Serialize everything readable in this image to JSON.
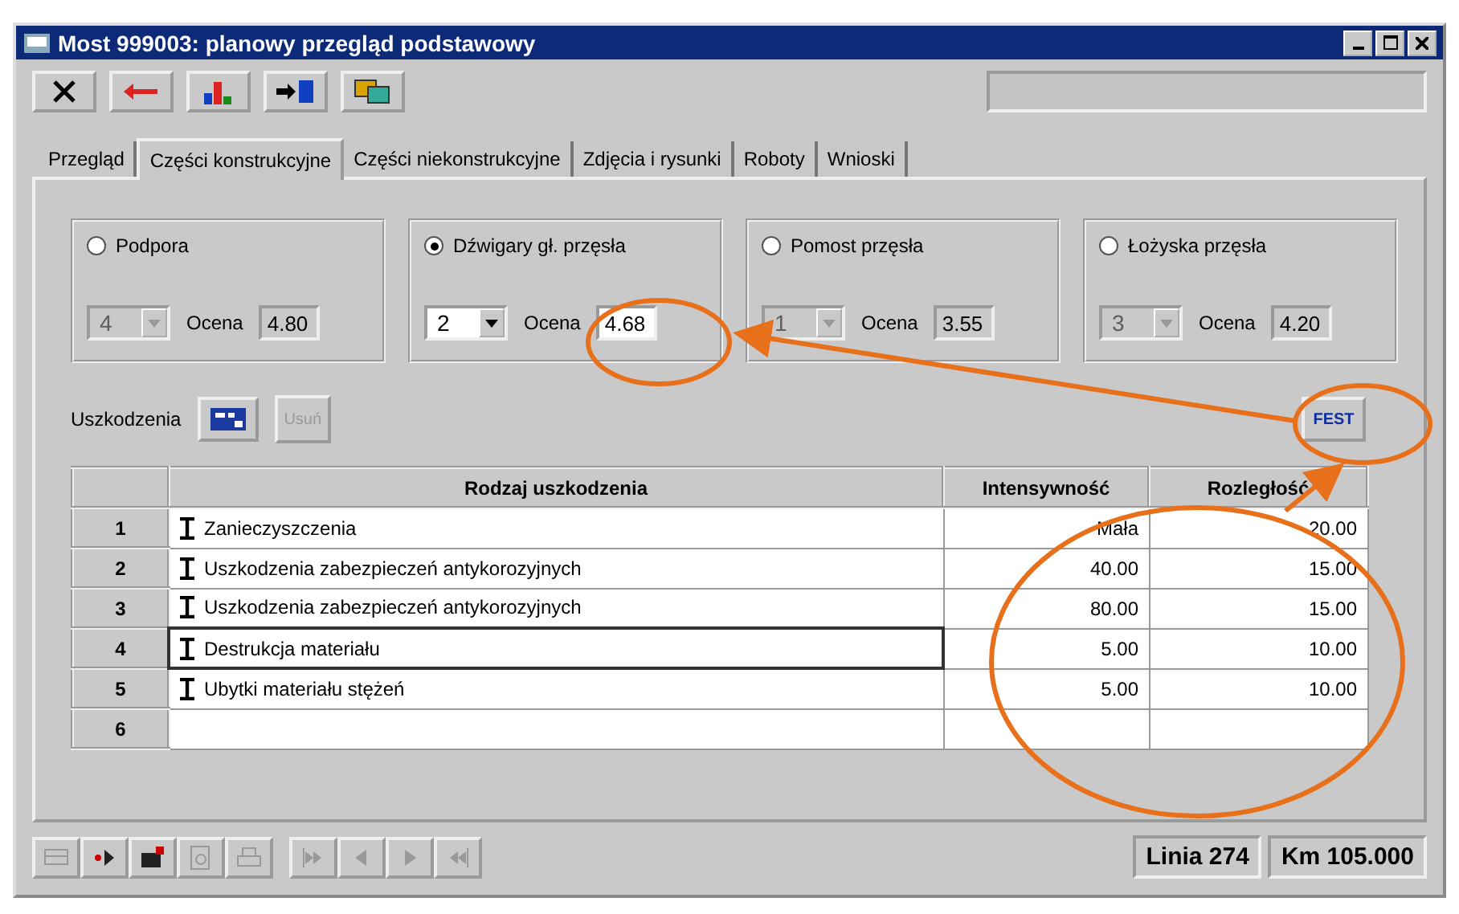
{
  "window": {
    "title": "Most 999003: planowy przegląd podstawowy"
  },
  "tabs": [
    {
      "label": "Przegląd",
      "selected": false
    },
    {
      "label": "Części konstrukcyjne",
      "selected": true
    },
    {
      "label": "Części niekonstrukcyjne",
      "selected": false
    },
    {
      "label": "Zdjęcia i rysunki",
      "selected": false
    },
    {
      "label": "Roboty",
      "selected": false
    },
    {
      "label": "Wnioski",
      "selected": false
    }
  ],
  "parts": [
    {
      "label": "Podpora",
      "selected": false,
      "number": "4",
      "disabled": true,
      "rating_label": "Ocena",
      "rating": "4.80"
    },
    {
      "label": "Dźwigary gł. przęsła",
      "selected": true,
      "number": "2",
      "disabled": false,
      "rating_label": "Ocena",
      "rating": "4.68"
    },
    {
      "label": "Pomost przęsła",
      "selected": false,
      "number": "1",
      "disabled": true,
      "rating_label": "Ocena",
      "rating": "3.55"
    },
    {
      "label": "Łożyska przęsła",
      "selected": false,
      "number": "3",
      "disabled": true,
      "rating_label": "Ocena",
      "rating": "4.20"
    }
  ],
  "damages": {
    "label": "Uszkodzenia",
    "delete_button": {
      "label": "Usuń",
      "disabled": true
    },
    "fest_button": "FEST"
  },
  "table": {
    "columns": [
      "Rodzaj uszkodzenia",
      "Intensywność",
      "Rozległość"
    ],
    "rows": [
      {
        "number": "1",
        "name": "Zanieczyszczenia",
        "intensity": "Mała",
        "extent": "20.00",
        "focused": false
      },
      {
        "number": "2",
        "name": "Uszkodzenia zabezpieczeń antykorozyjnych",
        "intensity": "40.00",
        "extent": "15.00",
        "focused": false
      },
      {
        "number": "3",
        "name": "Uszkodzenia zabezpieczeń antykorozyjnych",
        "intensity": "80.00",
        "extent": "15.00",
        "focused": false
      },
      {
        "number": "4",
        "name": "Destrukcja materiału",
        "intensity": "5.00",
        "extent": "10.00",
        "focused": true
      },
      {
        "number": "5",
        "name": "Ubytki materiału stężeń",
        "intensity": "5.00",
        "extent": "10.00",
        "focused": false
      },
      {
        "number": "6",
        "focused": false
      }
    ]
  },
  "bottom_toolbar": [
    {
      "disabled": true
    },
    {
      "disabled": false
    },
    {
      "disabled": false
    },
    {
      "disabled": true
    },
    {
      "disabled": true
    },
    {
      "disabled": true
    },
    {
      "disabled": true
    },
    {
      "disabled": true
    },
    {
      "disabled": true
    }
  ],
  "status": [
    "Linia 274",
    "Km 105.000"
  ]
}
